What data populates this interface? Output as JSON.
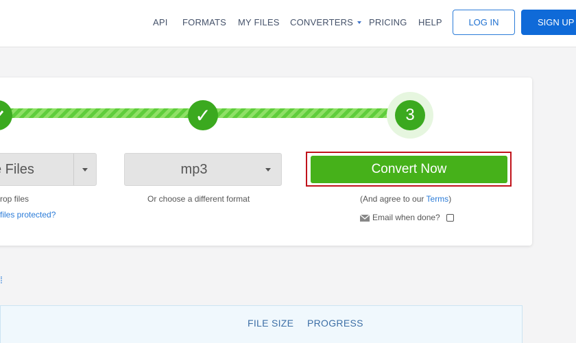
{
  "header": {
    "nav": [
      "API",
      "FORMATS",
      "MY FILES",
      "CONVERTERS",
      "PRICING",
      "HELP"
    ],
    "login_label": "LOG IN",
    "signup_label": "SIGN UP"
  },
  "steps": {
    "step1_icon": "check-icon",
    "step2_glyph": "✓",
    "step3_number": "3",
    "progress_fraction": 0.67
  },
  "file_picker": {
    "label": "e Files",
    "hint": "rop files",
    "link": "files protected?"
  },
  "format": {
    "selected": "mp3",
    "hint": "Or choose a different format"
  },
  "convert": {
    "button_label": "Convert Now",
    "agree_prefix": "(And agree to our ",
    "terms_link": "Terms",
    "agree_suffix": ")",
    "email_label": "Email when done?",
    "email_checked": false
  },
  "table": {
    "columns": [
      "FILE SIZE",
      "PROGRESS"
    ]
  },
  "colors": {
    "brand_blue": "#0f6ad8",
    "success_green": "#46b11a",
    "highlight_red": "#c0121a"
  }
}
